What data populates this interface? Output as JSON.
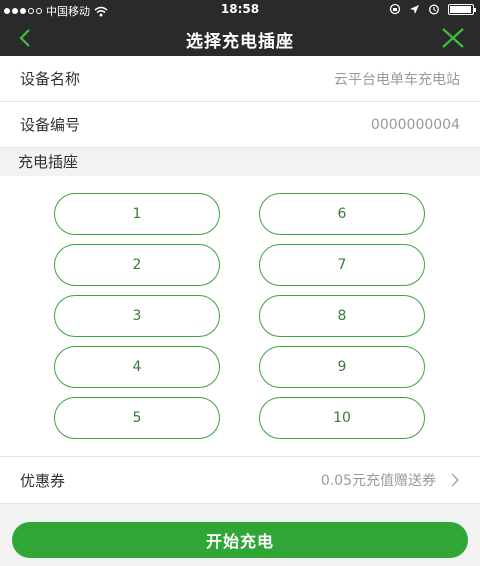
{
  "status_bar": {
    "carrier": "中国移动",
    "time": "18:58",
    "battery_level": 0.95,
    "icons": [
      "signal-icon",
      "wifi-icon",
      "rotation-lock-icon",
      "location-icon",
      "alarm-icon",
      "battery-icon"
    ]
  },
  "nav": {
    "title": "选择充电插座",
    "back_icon": "chevron-left-icon",
    "close_icon": "close-icon"
  },
  "device": {
    "name_label": "设备名称",
    "name_value": "云平台电单车充电站",
    "number_label": "设备编号",
    "number_value": "0000000004"
  },
  "sockets": {
    "header": "充电插座",
    "items": [
      "1",
      "6",
      "2",
      "7",
      "3",
      "8",
      "4",
      "9",
      "5",
      "10"
    ]
  },
  "coupon": {
    "label": "优惠券",
    "value": "0.05元充值赠送券"
  },
  "action": {
    "start_label": "开始充电"
  },
  "colors": {
    "accent": "#2fa636",
    "bar": "#2a2a2a",
    "socket_border": "#3fa23f"
  }
}
